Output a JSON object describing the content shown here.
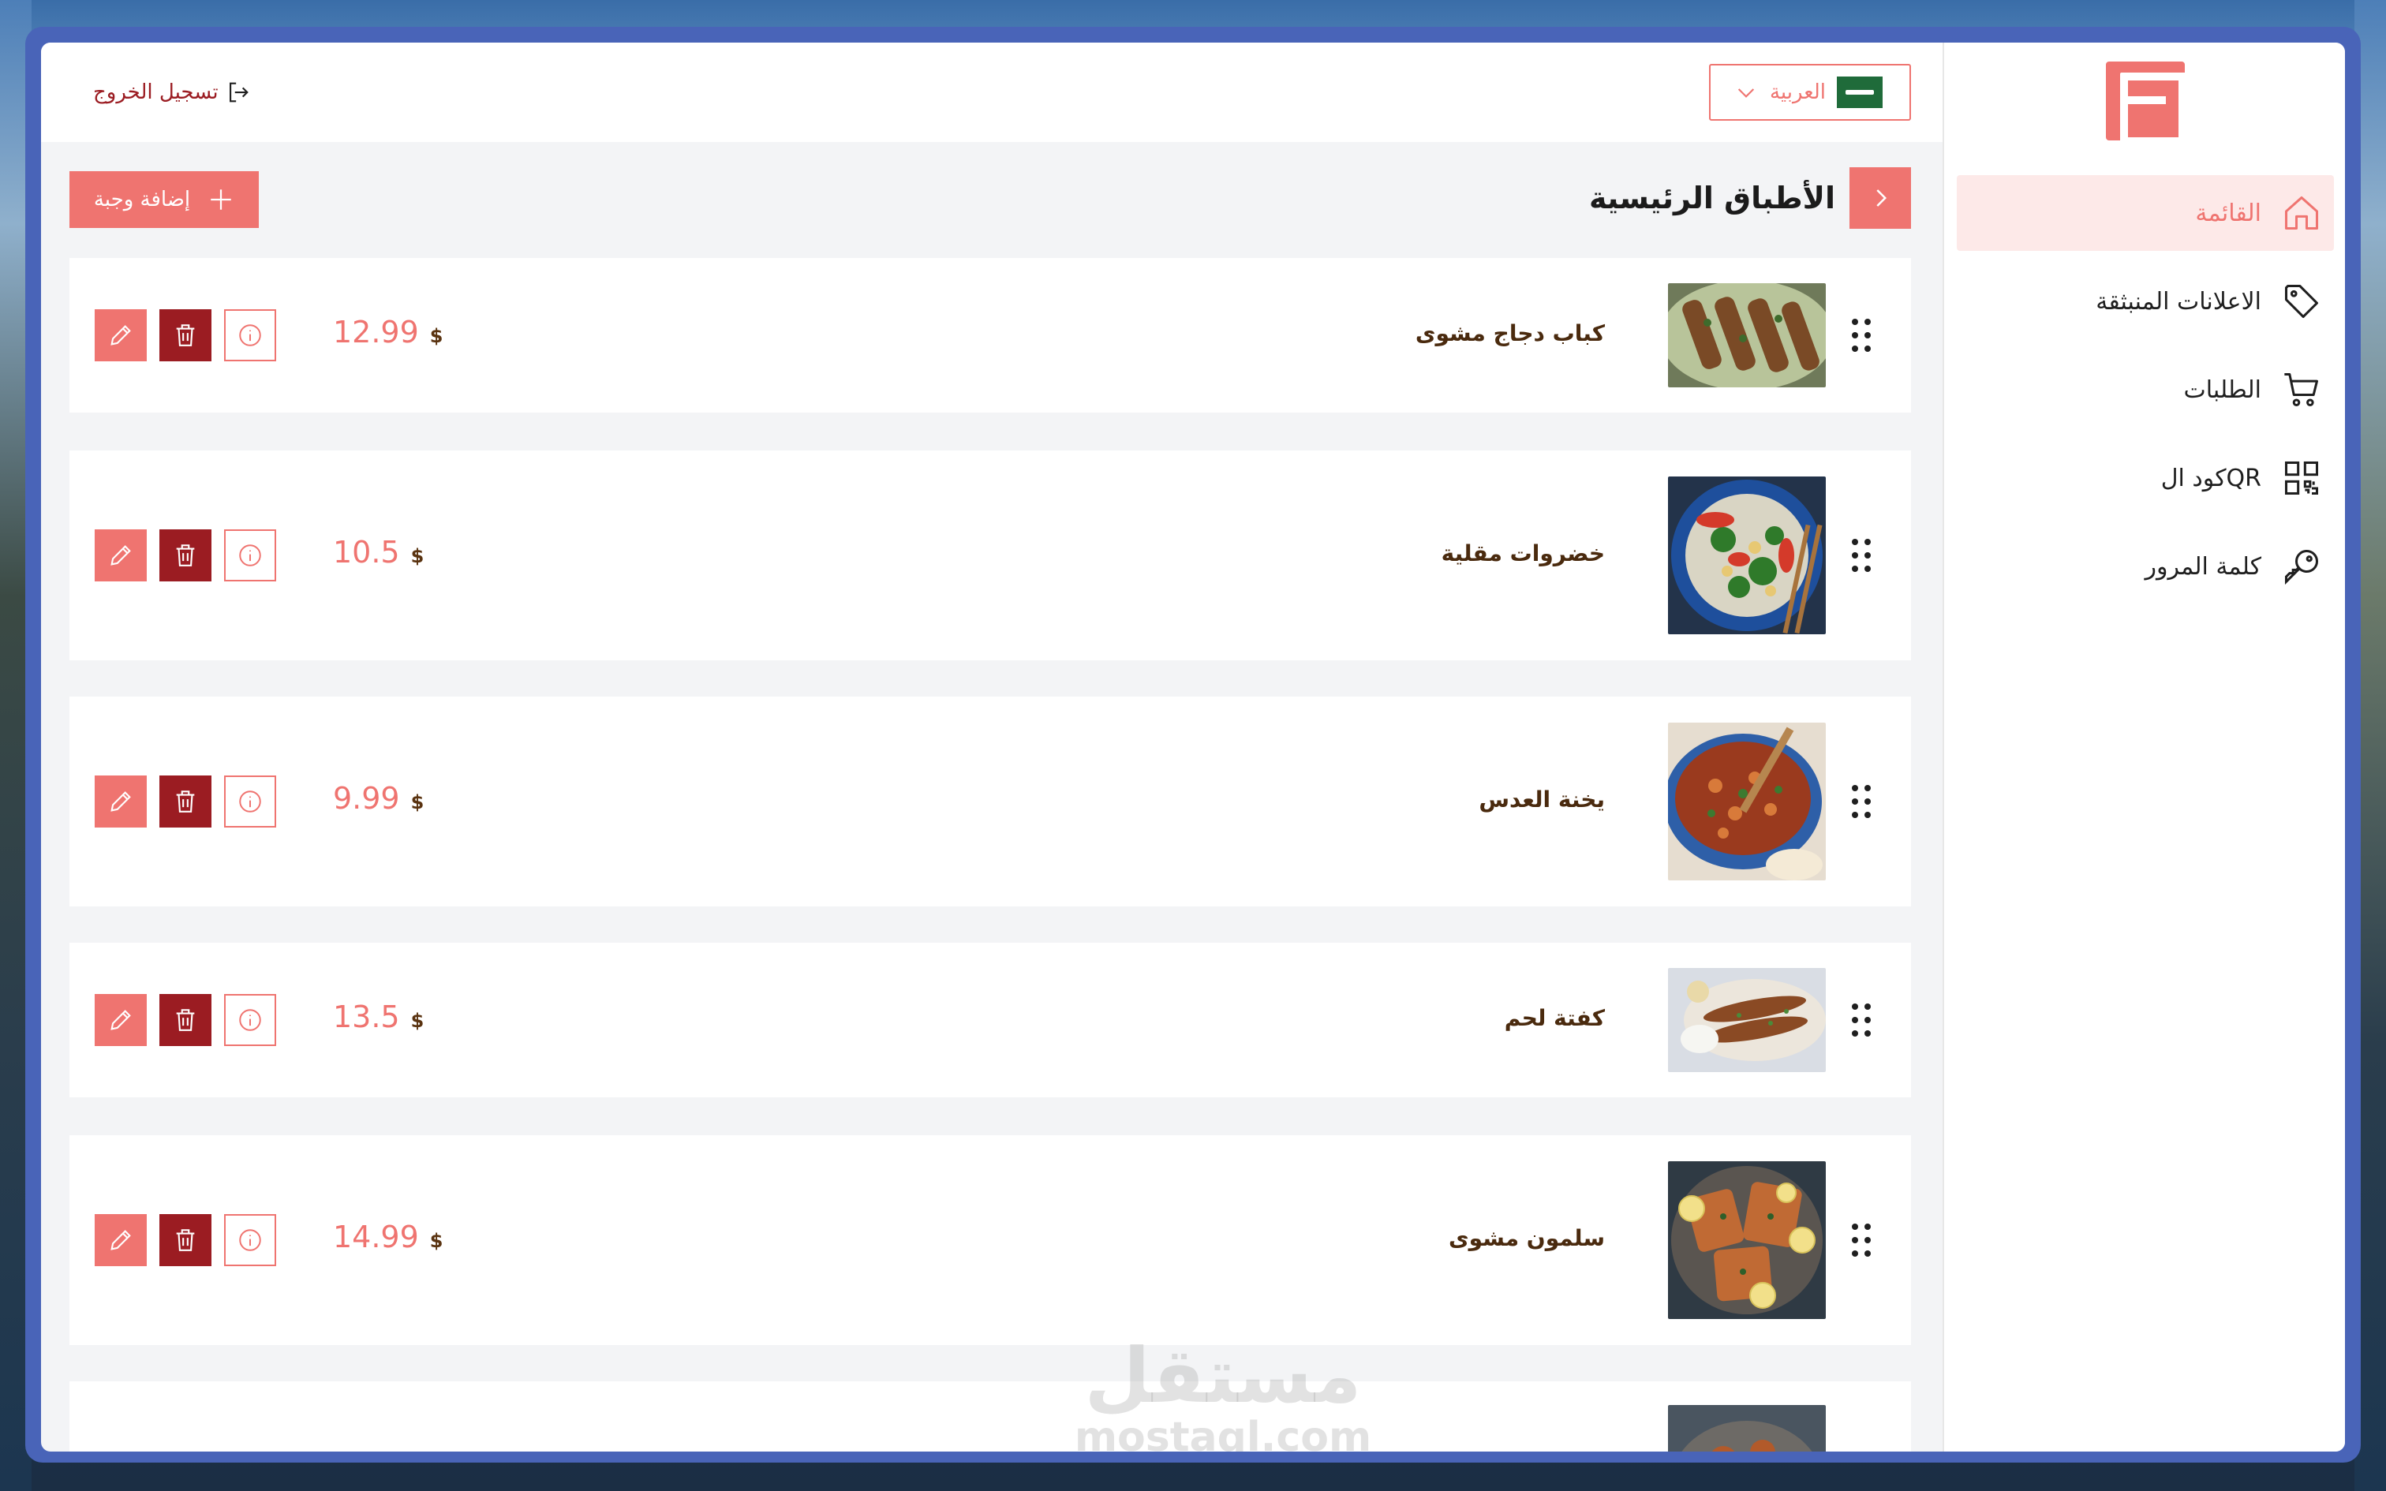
{
  "sidebar": {
    "items": [
      {
        "label": "القائمة",
        "icon": "home-icon",
        "active": true
      },
      {
        "label": "الاعلانات المنبثقة",
        "icon": "tag-icon",
        "active": false
      },
      {
        "label": "الطلبات",
        "icon": "cart-icon",
        "active": false
      },
      {
        "label": "كود الQR",
        "icon": "qr-code-icon",
        "active": false
      },
      {
        "label": "كلمة المرور",
        "icon": "key-icon",
        "active": false
      }
    ]
  },
  "topbar": {
    "logout_label": "تسجيل الخروج",
    "language_label": "العربية"
  },
  "section": {
    "title": "الأطباق الرئيسية",
    "add_label": "إضافة وجبة"
  },
  "items": [
    {
      "name": "كباب دجاج مشوى",
      "price": "12.99",
      "currency": "$"
    },
    {
      "name": "خضروات مقلية",
      "price": "10.5",
      "currency": "$"
    },
    {
      "name": "يخنة العدس",
      "price": "9.99",
      "currency": "$"
    },
    {
      "name": "كفتة لحم",
      "price": "13.5",
      "currency": "$"
    },
    {
      "name": "سلمون مشوى",
      "price": "14.99",
      "currency": "$"
    }
  ],
  "watermark": {
    "line1": "مستقل",
    "line2": "mostaql.com"
  },
  "colors": {
    "accent": "#ef7470",
    "danger": "#9b1c22",
    "text_brown": "#4a2a0e",
    "window_frame": "#4964b8"
  }
}
